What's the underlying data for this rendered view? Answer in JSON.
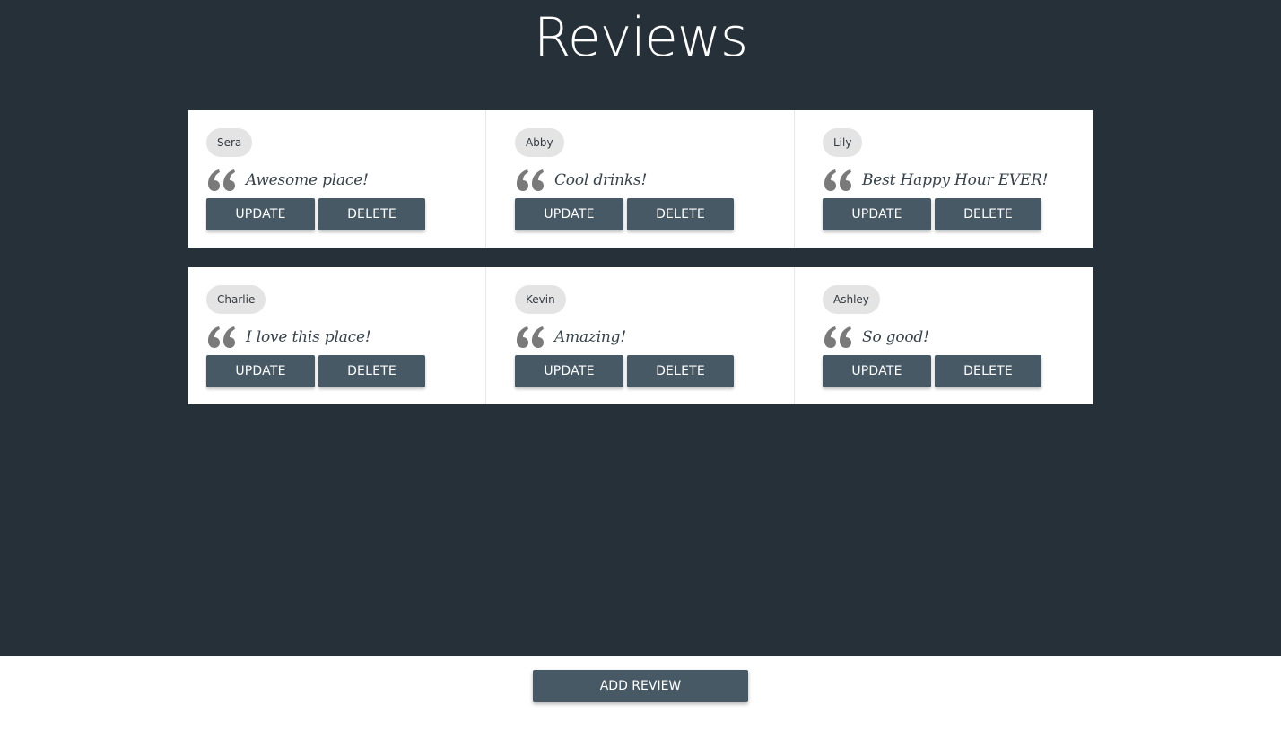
{
  "header": {
    "title": "Reviews"
  },
  "colors": {
    "background": "#263039",
    "card": "#ffffff",
    "button": "#465965",
    "chip": "#e4e4e4",
    "quote_icon": "#7a7a7a",
    "review_text": "#37434c"
  },
  "reviews": [
    {
      "author": "Sera",
      "text": "Awesome place!",
      "update_label": "UPDATE",
      "delete_label": "DELETE"
    },
    {
      "author": "Abby",
      "text": "Cool drinks!",
      "update_label": "UPDATE",
      "delete_label": "DELETE"
    },
    {
      "author": "Lily",
      "text": "Best Happy Hour EVER!",
      "update_label": "UPDATE",
      "delete_label": "DELETE"
    },
    {
      "author": "Charlie",
      "text": "I love this place!",
      "update_label": "UPDATE",
      "delete_label": "DELETE"
    },
    {
      "author": "Kevin",
      "text": "Amazing!",
      "update_label": "UPDATE",
      "delete_label": "DELETE"
    },
    {
      "author": "Ashley",
      "text": "So good!",
      "update_label": "UPDATE",
      "delete_label": "DELETE"
    }
  ],
  "footer": {
    "add_review_label": "ADD REVIEW"
  }
}
